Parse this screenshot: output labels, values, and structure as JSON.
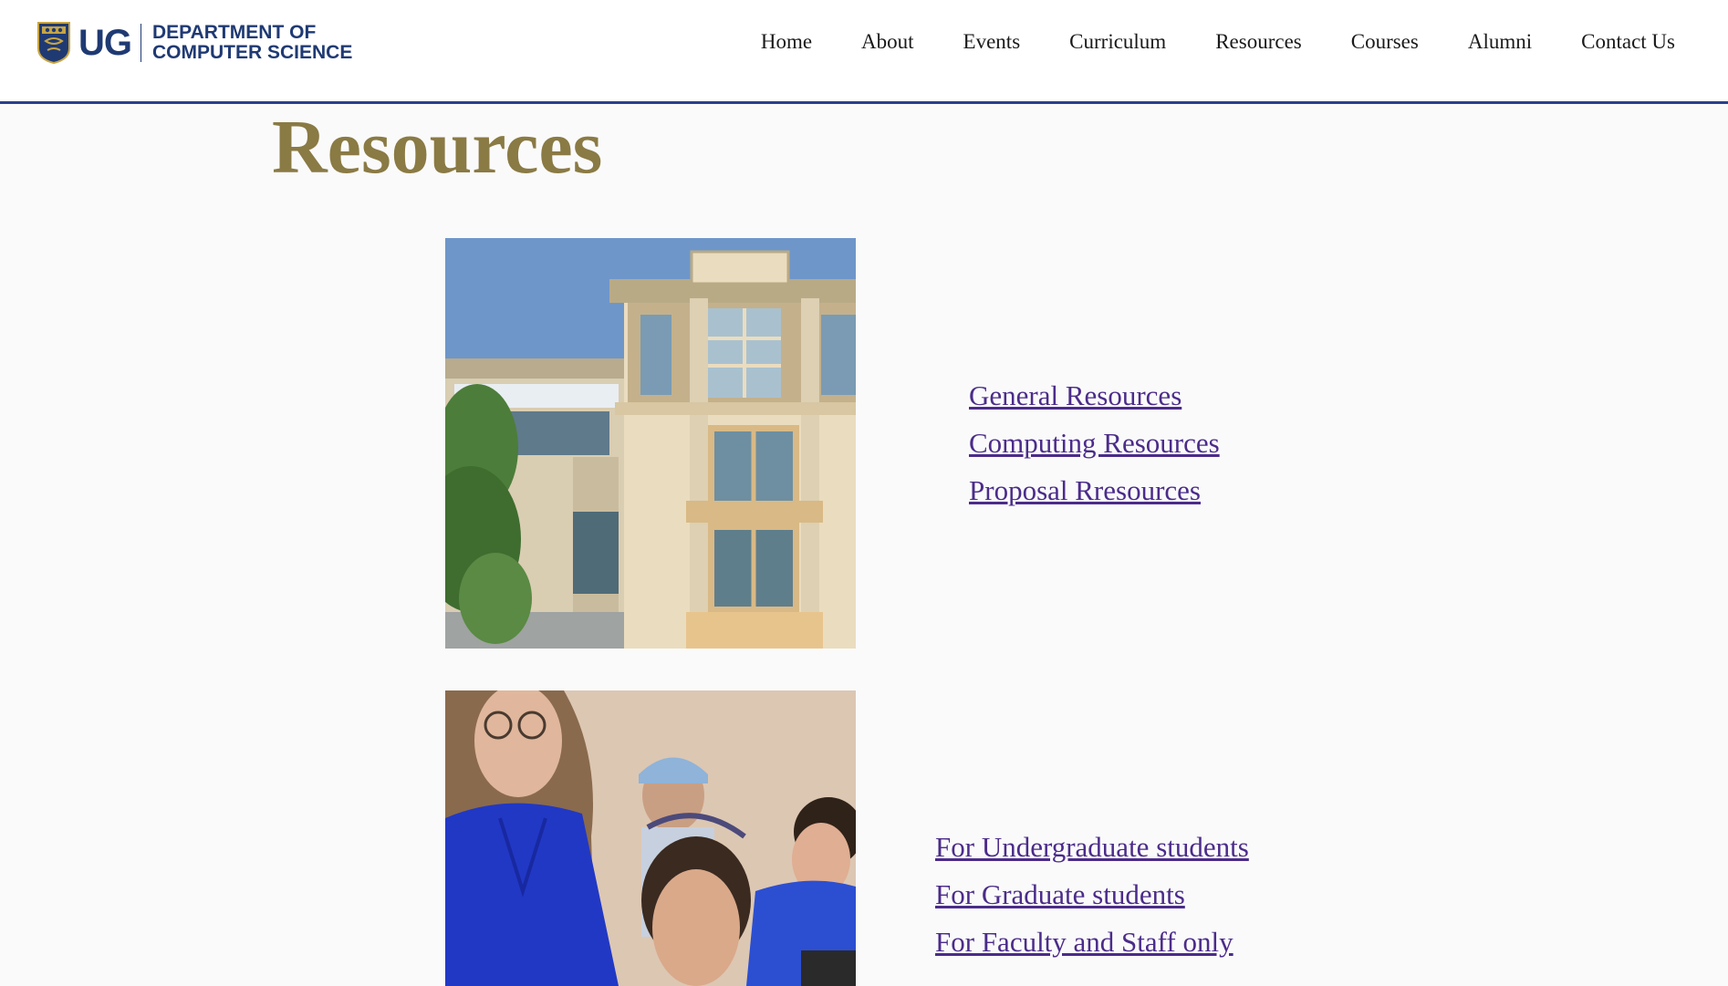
{
  "colors": {
    "brand_navy": "#1f3a73",
    "header_rule": "#2b3f8c",
    "title_gold": "#8a7a44",
    "link_purple": "#4b2c8a",
    "page_background": "#fafafa"
  },
  "header": {
    "logo": {
      "icon": "ug-crest-icon",
      "wordmark": "UG",
      "department_line1": "DEPARTMENT OF",
      "department_line2": "COMPUTER SCIENCE"
    },
    "nav": [
      {
        "label": "Home"
      },
      {
        "label": "About"
      },
      {
        "label": "Events"
      },
      {
        "label": "Curriculum"
      },
      {
        "label": "Resources"
      },
      {
        "label": "Courses"
      },
      {
        "label": "Alumni"
      },
      {
        "label": "Contact Us"
      }
    ]
  },
  "main": {
    "title": "Resources",
    "sections": [
      {
        "image": "building-photo",
        "links": [
          {
            "label": "General Resources"
          },
          {
            "label": "Computing Resources"
          },
          {
            "label": "Proposal Rresources"
          }
        ]
      },
      {
        "image": "classroom-photo",
        "links": [
          {
            "label": "For Undergraduate students"
          },
          {
            "label": "For Graduate students"
          },
          {
            "label": "For Faculty and Staff only"
          }
        ]
      }
    ]
  }
}
